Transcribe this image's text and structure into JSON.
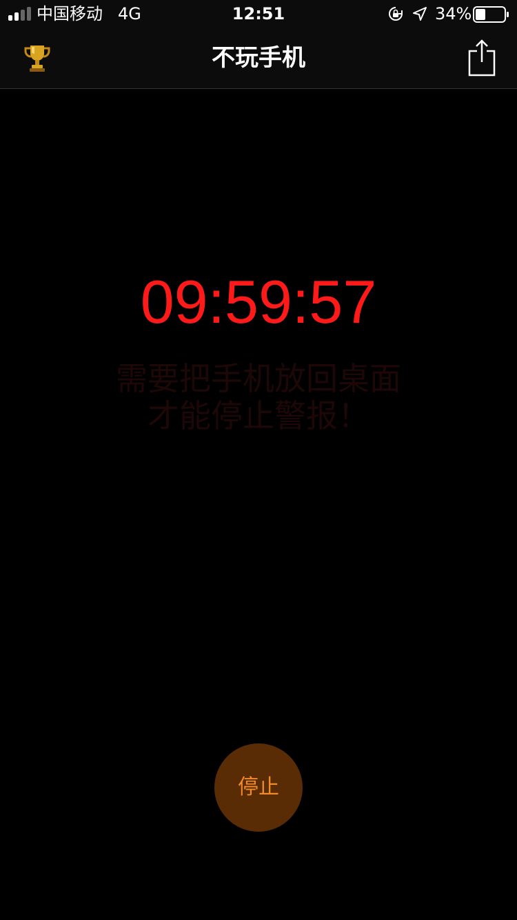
{
  "status_bar": {
    "carrier": "中国移动",
    "network": "4G",
    "time": "12:51",
    "battery_percent": "34%",
    "battery_level": 0.34,
    "signal_bars_filled": 2,
    "signal_bars_total": 4
  },
  "nav": {
    "title": "不玩手机",
    "left_icon": "trophy-icon",
    "right_icon": "share-icon"
  },
  "main": {
    "timer": "09:59:57",
    "hint_line1": "需要把手机放回桌面",
    "hint_line2": "才能停止警报！"
  },
  "actions": {
    "stop_label": "停止"
  },
  "colors": {
    "background": "#000000",
    "bar_background": "#0c0c0c",
    "timer": "#ff1a1a",
    "hint": "#1e0707",
    "stop_button_bg": "#5a2c05",
    "stop_button_text": "#f28a2a"
  }
}
